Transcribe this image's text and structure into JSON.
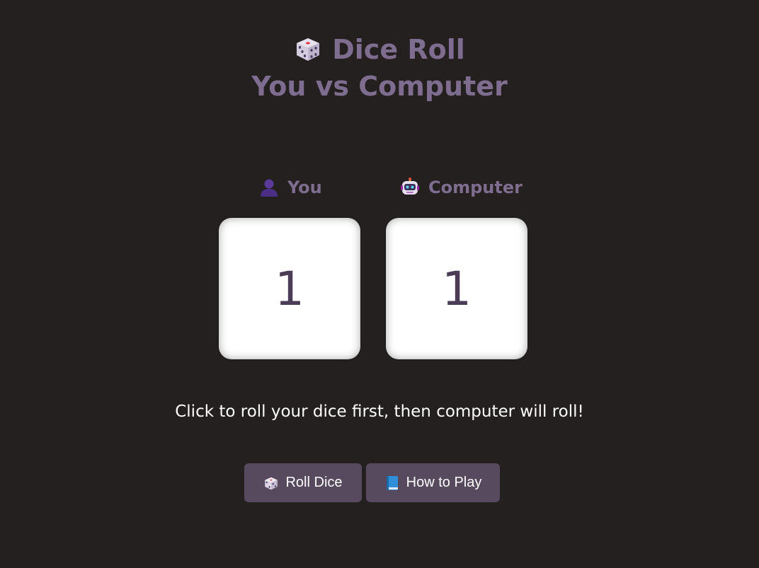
{
  "header": {
    "title_line1": "Dice Roll",
    "title_line2": "You vs Computer",
    "title_icon": "dice-icon"
  },
  "players": {
    "you": {
      "label": "You",
      "icon": "user-icon"
    },
    "computer": {
      "label": "Computer",
      "icon": "robot-icon"
    }
  },
  "dice": {
    "you_value": "1",
    "computer_value": "1"
  },
  "status": {
    "message": "Click to roll your dice first, then computer will roll!"
  },
  "buttons": {
    "roll_label": "Roll Dice",
    "roll_icon": "dice-icon",
    "howto_label": "How to Play",
    "howto_icon": "book-icon"
  },
  "colors": {
    "background": "#242020",
    "accent": "#7e6d8f",
    "button": "#574a5e",
    "die_face": "#ffffff",
    "die_number": "#4a3d55"
  }
}
